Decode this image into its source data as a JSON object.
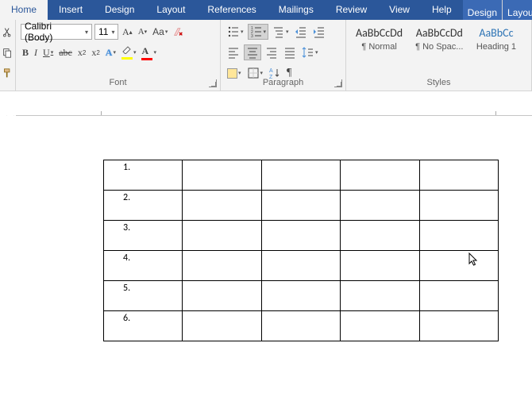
{
  "tabs": {
    "home": "Home",
    "insert": "Insert",
    "design": "Design",
    "layout": "Layout",
    "references": "References",
    "mailings": "Mailings",
    "review": "Review",
    "view": "View",
    "help": "Help",
    "tt_design": "Design",
    "tt_layout": "Layout"
  },
  "font": {
    "name": "Calibri (Body)",
    "size": "11",
    "group_label": "Font"
  },
  "paragraph": {
    "group_label": "Paragraph"
  },
  "styles": {
    "group_label": "Styles",
    "items": [
      {
        "preview": "AaBbCcDd",
        "name": "¶ Normal",
        "class": ""
      },
      {
        "preview": "AaBbCcDd",
        "name": "¶ No Spac...",
        "class": ""
      },
      {
        "preview": "AaBbCc",
        "name": "Heading 1",
        "class": "h1"
      }
    ]
  },
  "table": {
    "rows": [
      "1.",
      "2.",
      "3.",
      "4.",
      "5.",
      "6."
    ],
    "cols": 5
  }
}
